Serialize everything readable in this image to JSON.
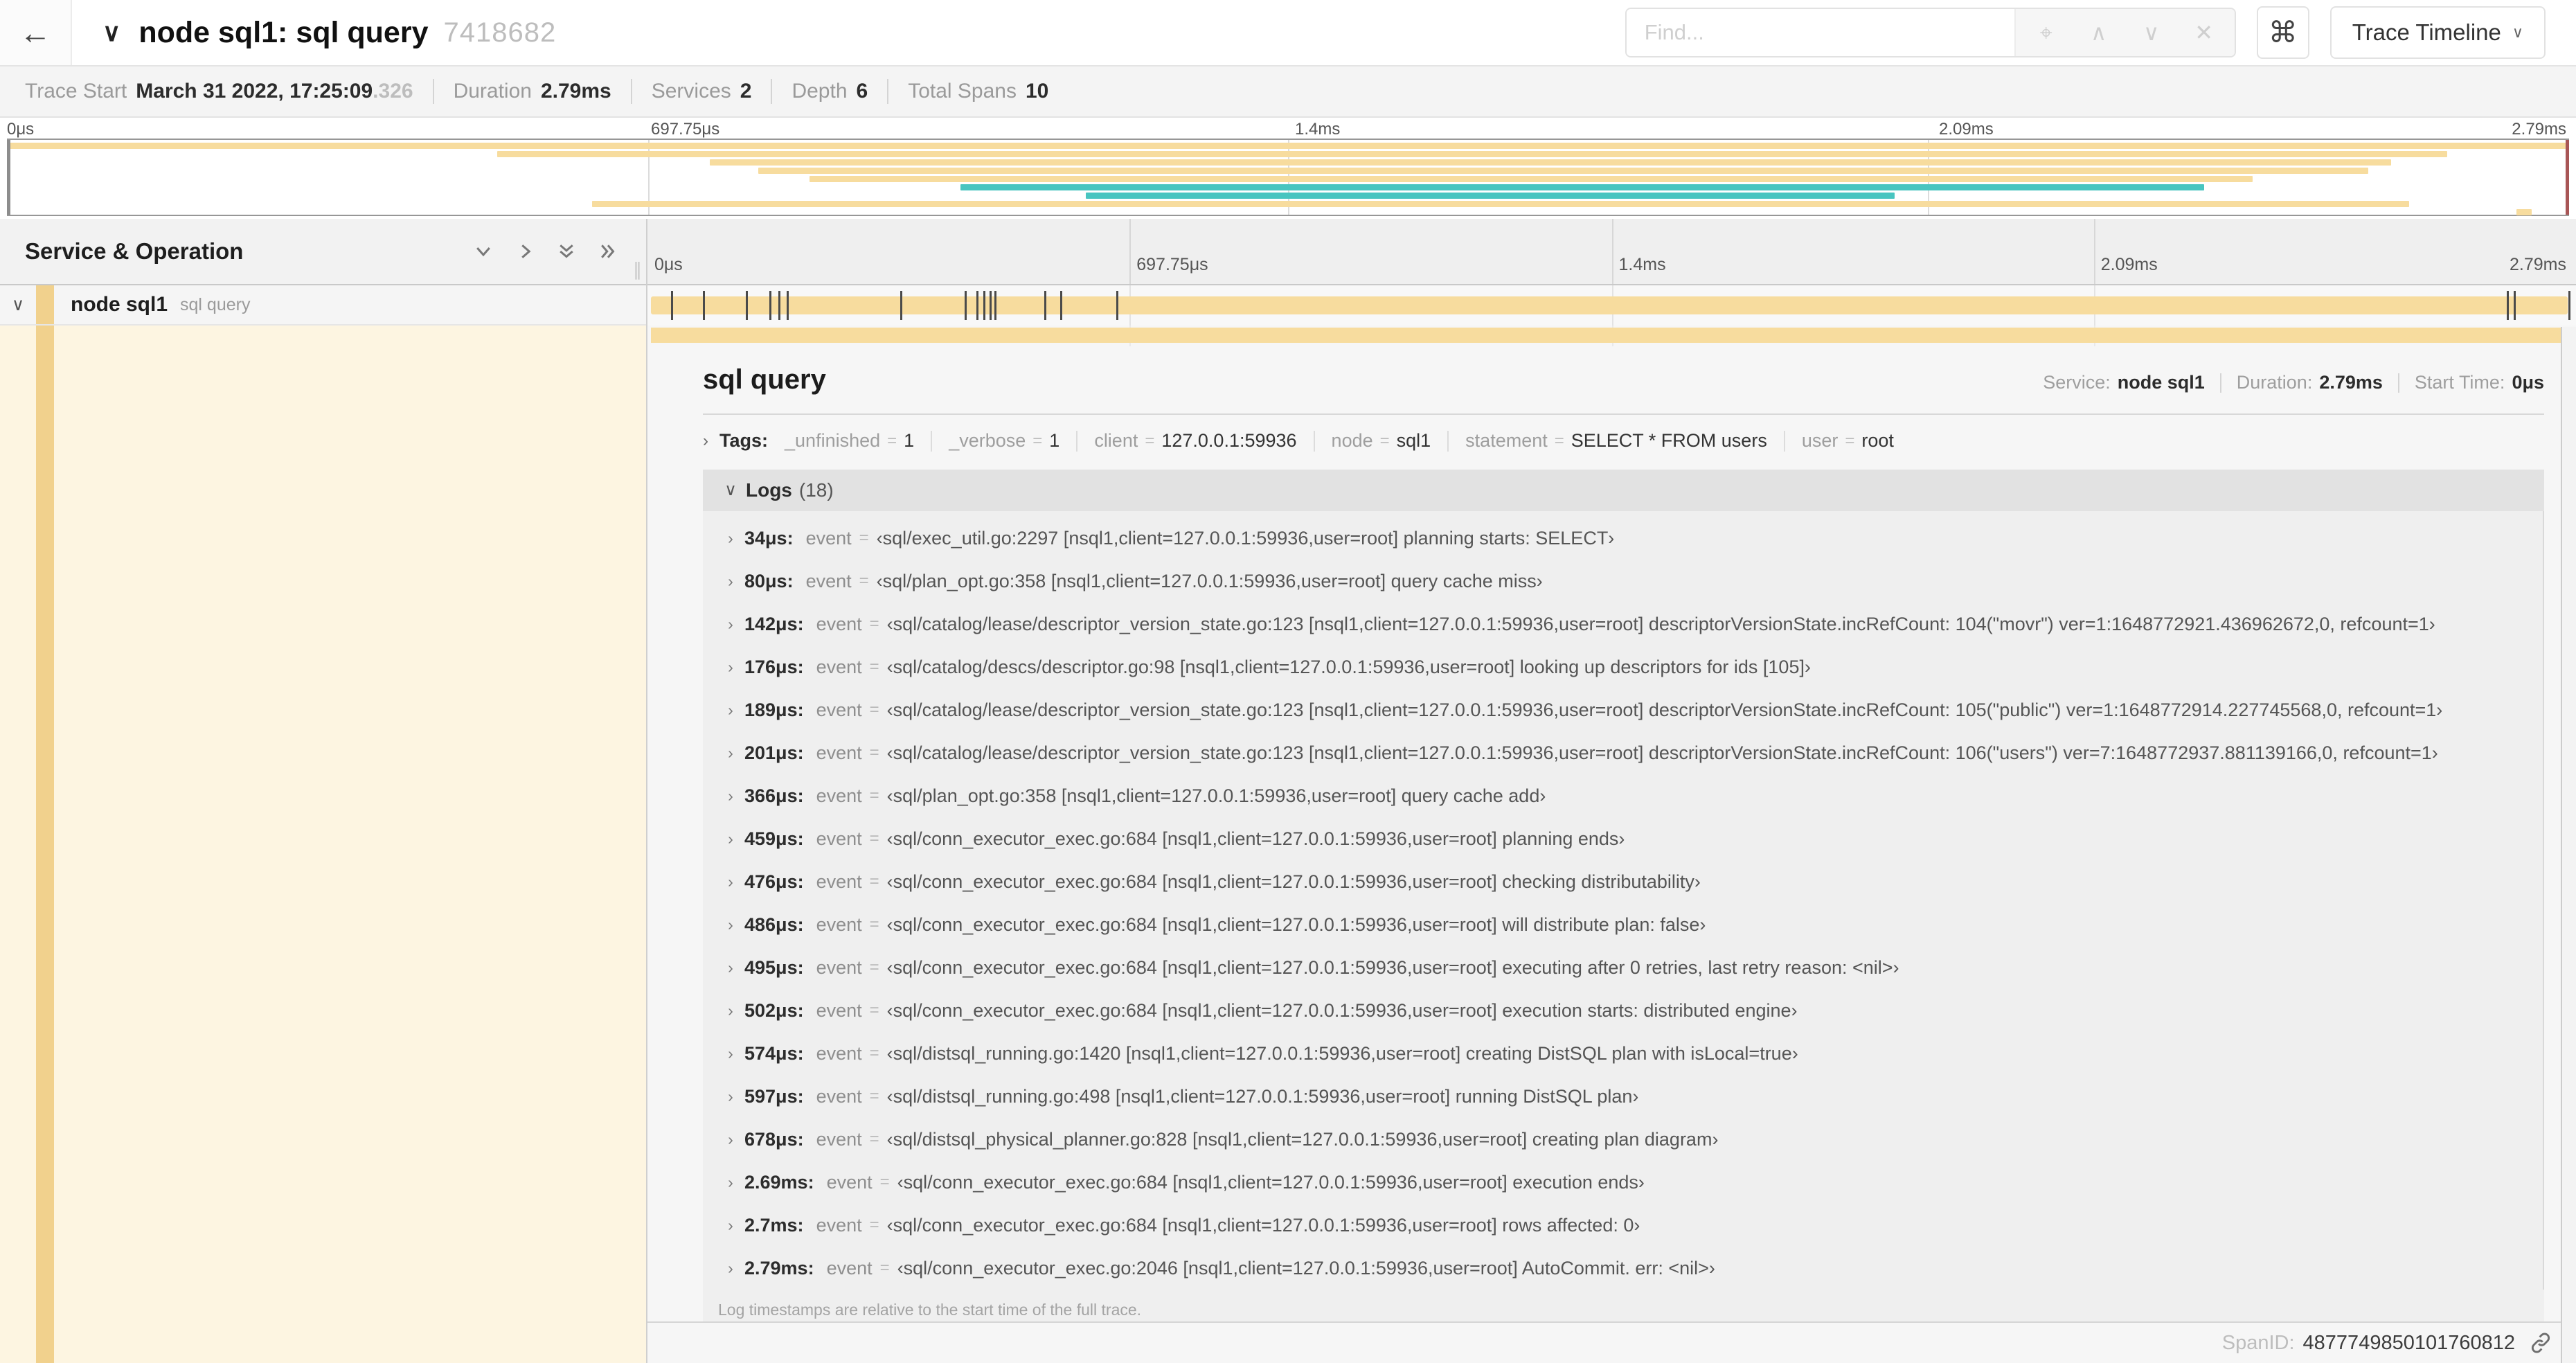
{
  "icons": {
    "back": "←",
    "chevron_down": "∨",
    "chevron_right": "›",
    "locate": "⌖",
    "up_arrow": "∧",
    "down_arrow": "∨",
    "close": "✕",
    "grip": "∥"
  },
  "header": {
    "title": "node sql1: sql query",
    "trace_id": "7418682",
    "find_placeholder": "Find...",
    "shortcut": "⌘",
    "view_selector": "Trace Timeline"
  },
  "summary": {
    "trace_start_label": "Trace Start",
    "trace_start": "March 31 2022, 17:25:09",
    "trace_start_suffix": ".326",
    "duration_label": "Duration",
    "duration": "2.79ms",
    "services_label": "Services",
    "services": "2",
    "depth_label": "Depth",
    "depth": "6",
    "total_spans_label": "Total Spans",
    "total_spans": "10"
  },
  "timeline": {
    "duration_us": 2790,
    "ticks": [
      "0μs",
      "697.75μs",
      "1.4ms",
      "2.09ms",
      "2.79ms"
    ],
    "tick_positions_pct": [
      0,
      25,
      50,
      75,
      100
    ],
    "minimap_spans": [
      {
        "left_pct": 0,
        "width_pct": 100,
        "color": "tan"
      },
      {
        "left_pct": 19.1,
        "width_pct": 76.2,
        "color": "tan"
      },
      {
        "left_pct": 27.4,
        "width_pct": 65.7,
        "color": "tan"
      },
      {
        "left_pct": 29.3,
        "width_pct": 62.9,
        "color": "tan"
      },
      {
        "left_pct": 31.3,
        "width_pct": 56.4,
        "color": "tan"
      },
      {
        "left_pct": 37.2,
        "width_pct": 48.6,
        "color": "teal"
      },
      {
        "left_pct": 42.1,
        "width_pct": 31.6,
        "color": "teal"
      },
      {
        "left_pct": 22.8,
        "width_pct": 71.0,
        "color": "tan"
      },
      {
        "left_pct": 98.0,
        "width_pct": 0.6,
        "color": "tan"
      }
    ],
    "log_marks_us": [
      34,
      80,
      142,
      176,
      189,
      201,
      366,
      459,
      476,
      486,
      495,
      502,
      574,
      597,
      678,
      2690,
      2700,
      2785
    ]
  },
  "left_panel": {
    "header": "Service & Operation",
    "row": {
      "service": "node sql1",
      "operation": "sql query"
    }
  },
  "span_detail": {
    "title": "sql query",
    "service_label": "Service:",
    "service": "node sql1",
    "duration_label": "Duration:",
    "duration": "2.79ms",
    "start_label": "Start Time:",
    "start": "0μs",
    "tags_label": "Tags:",
    "tags": [
      {
        "key": "_unfinished",
        "value": "1"
      },
      {
        "key": "_verbose",
        "value": "1"
      },
      {
        "key": "client",
        "value": "127.0.0.1:59936"
      },
      {
        "key": "node",
        "value": "sql1"
      },
      {
        "key": "statement",
        "value": "SELECT * FROM users"
      },
      {
        "key": "user",
        "value": "root"
      }
    ],
    "logs_label": "Logs",
    "logs_count": "(18)",
    "log_field": "event",
    "logs": [
      {
        "time": "34μs:",
        "value": "‹sql/exec_util.go:2297 [nsql1,client=127.0.0.1:59936,user=root] planning starts: SELECT›"
      },
      {
        "time": "80μs:",
        "value": "‹sql/plan_opt.go:358 [nsql1,client=127.0.0.1:59936,user=root] query cache miss›"
      },
      {
        "time": "142μs:",
        "value": "‹sql/catalog/lease/descriptor_version_state.go:123 [nsql1,client=127.0.0.1:59936,user=root] descriptorVersionState.incRefCount: 104(\"movr\") ver=1:1648772921.436962672,0, refcount=1›"
      },
      {
        "time": "176μs:",
        "value": "‹sql/catalog/descs/descriptor.go:98 [nsql1,client=127.0.0.1:59936,user=root] looking up descriptors for ids [105]›"
      },
      {
        "time": "189μs:",
        "value": "‹sql/catalog/lease/descriptor_version_state.go:123 [nsql1,client=127.0.0.1:59936,user=root] descriptorVersionState.incRefCount: 105(\"public\") ver=1:1648772914.227745568,0, refcount=1›"
      },
      {
        "time": "201μs:",
        "value": "‹sql/catalog/lease/descriptor_version_state.go:123 [nsql1,client=127.0.0.1:59936,user=root] descriptorVersionState.incRefCount: 106(\"users\") ver=7:1648772937.881139166,0, refcount=1›"
      },
      {
        "time": "366μs:",
        "value": "‹sql/plan_opt.go:358 [nsql1,client=127.0.0.1:59936,user=root] query cache add›"
      },
      {
        "time": "459μs:",
        "value": "‹sql/conn_executor_exec.go:684 [nsql1,client=127.0.0.1:59936,user=root] planning ends›"
      },
      {
        "time": "476μs:",
        "value": "‹sql/conn_executor_exec.go:684 [nsql1,client=127.0.0.1:59936,user=root] checking distributability›"
      },
      {
        "time": "486μs:",
        "value": "‹sql/conn_executor_exec.go:684 [nsql1,client=127.0.0.1:59936,user=root] will distribute plan: false›"
      },
      {
        "time": "495μs:",
        "value": "‹sql/conn_executor_exec.go:684 [nsql1,client=127.0.0.1:59936,user=root] executing after 0 retries, last retry reason: <nil>›"
      },
      {
        "time": "502μs:",
        "value": "‹sql/conn_executor_exec.go:684 [nsql1,client=127.0.0.1:59936,user=root] execution starts: distributed engine›"
      },
      {
        "time": "574μs:",
        "value": "‹sql/distsql_running.go:1420 [nsql1,client=127.0.0.1:59936,user=root] creating DistSQL plan with isLocal=true›"
      },
      {
        "time": "597μs:",
        "value": "‹sql/distsql_running.go:498 [nsql1,client=127.0.0.1:59936,user=root] running DistSQL plan›"
      },
      {
        "time": "678μs:",
        "value": "‹sql/distsql_physical_planner.go:828 [nsql1,client=127.0.0.1:59936,user=root] creating plan diagram›"
      },
      {
        "time": "2.69ms:",
        "value": "‹sql/conn_executor_exec.go:684 [nsql1,client=127.0.0.1:59936,user=root] execution ends›"
      },
      {
        "time": "2.7ms:",
        "value": "‹sql/conn_executor_exec.go:684 [nsql1,client=127.0.0.1:59936,user=root] rows affected: 0›"
      },
      {
        "time": "2.79ms:",
        "value": "‹sql/conn_executor_exec.go:2046 [nsql1,client=127.0.0.1:59936,user=root] AutoCommit. err: <nil>›"
      }
    ],
    "logs_note": "Log timestamps are relative to the start time of the full trace.",
    "span_id_label": "SpanID:",
    "span_id": "4877749850101760812"
  },
  "colors": {
    "tan": "#f7dc9e",
    "teal": "#48c5c0"
  }
}
